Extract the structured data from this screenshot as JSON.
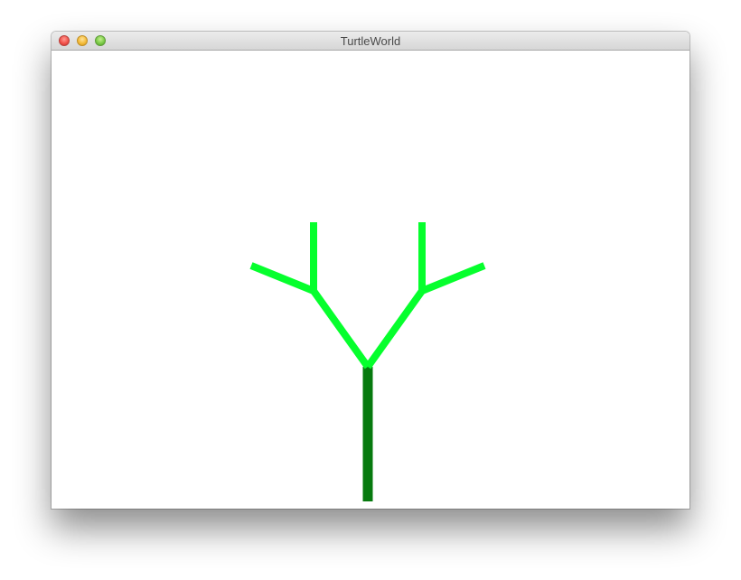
{
  "window": {
    "title": "TurtleWorld"
  },
  "controls": {
    "close_icon": "close-icon",
    "minimize_icon": "minimize-icon",
    "zoom_icon": "zoom-icon"
  },
  "drawing": {
    "trunk_color": "#067a0e",
    "branch_color": "#06ff2d"
  }
}
